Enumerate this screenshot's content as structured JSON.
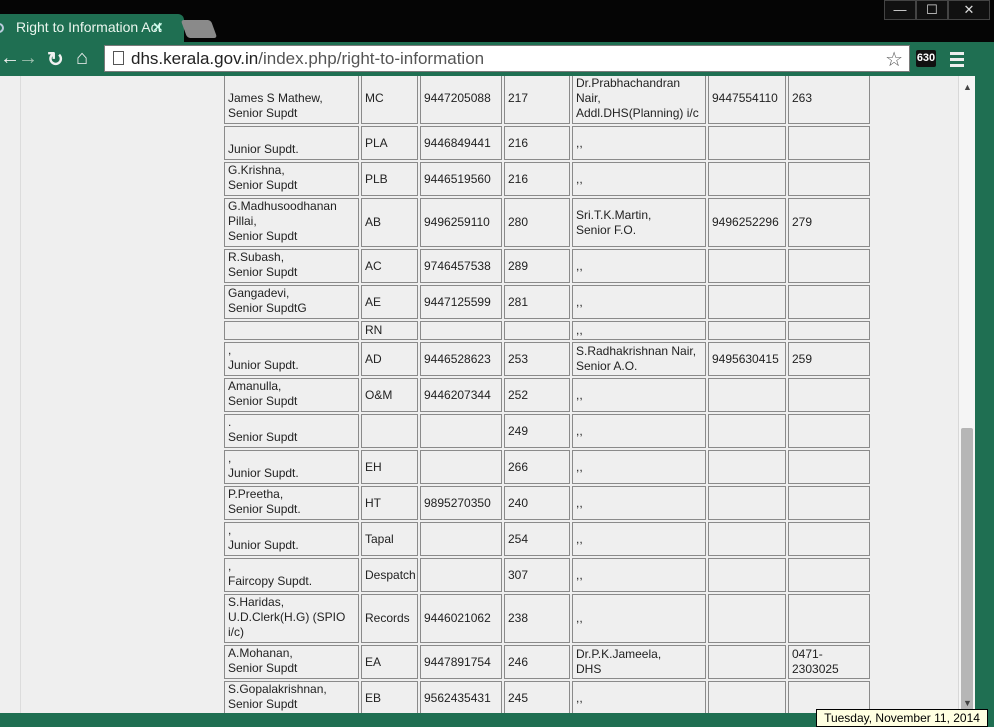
{
  "browser": {
    "tab_title": "Right to Information Act",
    "tab_close": "✕",
    "url_domain": "dhs.kerala.gov.in",
    "url_path": "/index.php/right-to-information",
    "extension_label": "630",
    "window_buttons": {
      "minimize": "—",
      "maximize": "☐",
      "close": "✕"
    },
    "icons": [
      "back-icon",
      "forward-icon",
      "reload-icon",
      "home-icon",
      "page-icon",
      "star-icon",
      "menu-icon"
    ]
  },
  "table": {
    "rows": [
      {
        "name": "James S Mathew,\nSenior Supdt",
        "section": "MC",
        "phone": "9447205088",
        "ext": "217",
        "officer": "Dr.Prabhachandran Nair,\nAddl.DHS(Planning) i/c",
        "officer_phone": "9447554110",
        "officer_ext": "263"
      },
      {
        "name": "Junior Supdt.",
        "section": "PLA",
        "phone": "9446849441",
        "ext": "216",
        "officer": ",,",
        "officer_phone": "",
        "officer_ext": ""
      },
      {
        "name": "G.Krishna,\nSenior Supdt",
        "section": "PLB",
        "phone": "9446519560",
        "ext": "216",
        "officer": ",,",
        "officer_phone": "",
        "officer_ext": ""
      },
      {
        "name": "G.Madhusoodhanan Pillai,\nSenior Supdt",
        "section": "AB",
        "phone": "9496259110",
        "ext": "280",
        "officer": "Sri.T.K.Martin,\nSenior F.O.",
        "officer_phone": "9496252296",
        "officer_ext": "279"
      },
      {
        "name": "R.Subash,\nSenior Supdt",
        "section": "AC",
        "phone": "9746457538",
        "ext": "289",
        "officer": ",,",
        "officer_phone": "",
        "officer_ext": ""
      },
      {
        "name": "Gangadevi,\nSenior SupdtG",
        "section": "AE",
        "phone": "9447125599",
        "ext": "281",
        "officer": ",,",
        "officer_phone": "",
        "officer_ext": ""
      },
      {
        "name": "",
        "section": "RN",
        "phone": "",
        "ext": "",
        "officer": ",,",
        "officer_phone": "",
        "officer_ext": ""
      },
      {
        "name": ",\nJunior Supdt.",
        "section": "AD",
        "phone": "9446528623",
        "ext": "253",
        "officer": "S.Radhakrishnan Nair,\nSenior A.O.",
        "officer_phone": "9495630415",
        "officer_ext": "259"
      },
      {
        "name": "Amanulla,\nSenior Supdt",
        "section": "O&M",
        "phone": "9446207344",
        "ext": "252",
        "officer": ",,",
        "officer_phone": "",
        "officer_ext": ""
      },
      {
        "name": ".\nSenior Supdt",
        "section": "",
        "phone": "",
        "ext": "249",
        "officer": ",,",
        "officer_phone": "",
        "officer_ext": ""
      },
      {
        "name": ",\nJunior Supdt.",
        "section": "EH",
        "phone": "",
        "ext": "266",
        "officer": ",,",
        "officer_phone": "",
        "officer_ext": ""
      },
      {
        "name": "P.Preetha,\nSenior Supdt.",
        "section": "HT",
        "phone": "9895270350",
        "ext": "240",
        "officer": ",,",
        "officer_phone": "",
        "officer_ext": ""
      },
      {
        "name": ",\nJunior Supdt.",
        "section": "Tapal",
        "phone": "",
        "ext": "254",
        "officer": ",,",
        "officer_phone": "",
        "officer_ext": ""
      },
      {
        "name": ",\nFaircopy Supdt.",
        "section": "Despatch",
        "phone": "",
        "ext": "307",
        "officer": ",,",
        "officer_phone": "",
        "officer_ext": ""
      },
      {
        "name": "S.Haridas,\nU.D.Clerk(H.G) (SPIO i/c)",
        "section": "Records",
        "phone": "9446021062",
        "ext": "238",
        "officer": ",,",
        "officer_phone": "",
        "officer_ext": ""
      },
      {
        "name": "A.Mohanan,\nSenior Supdt",
        "section": "EA",
        "phone": "9447891754",
        "ext": "246",
        "officer": "Dr.P.K.Jameela,\nDHS",
        "officer_phone": "",
        "officer_ext": "0471-2303025"
      },
      {
        "name": "S.Gopalakrishnan,\nSenior Supdt",
        "section": "EB",
        "phone": "9562435431",
        "ext": "245",
        "officer": ",,",
        "officer_phone": "",
        "officer_ext": ""
      }
    ]
  },
  "taskbar": {
    "clock": "Tuesday, November 11, 2014"
  }
}
